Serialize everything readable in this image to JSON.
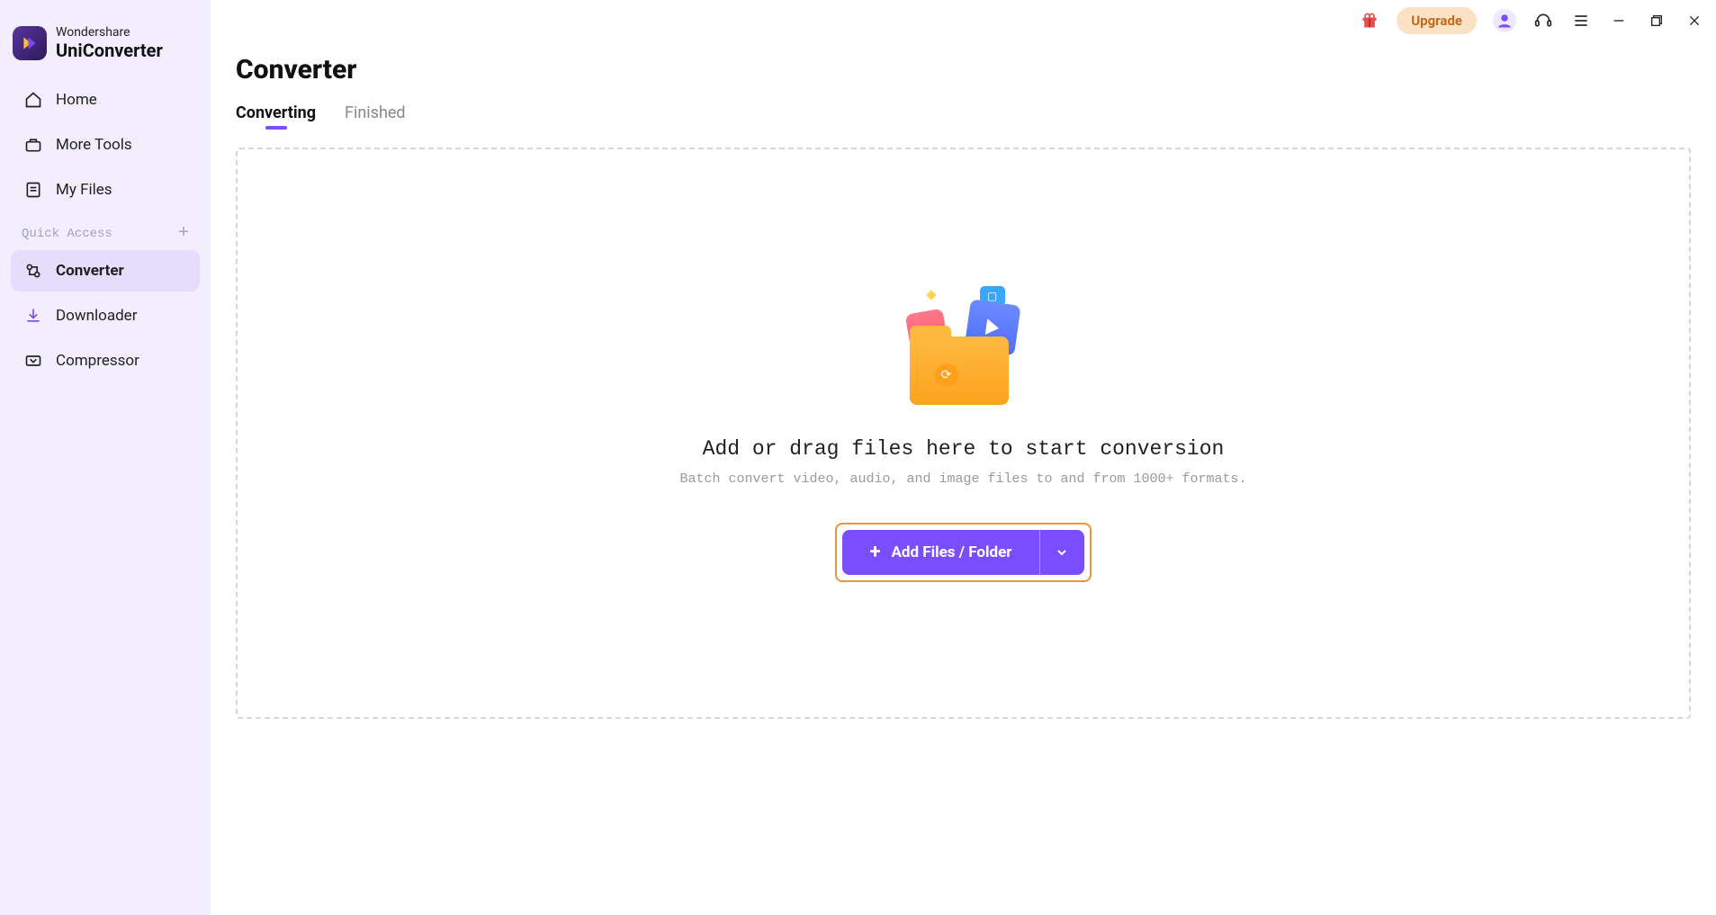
{
  "brand": {
    "top": "Wondershare",
    "bottom": "UniConverter"
  },
  "sidebar": {
    "nav": {
      "home": "Home",
      "more_tools": "More Tools",
      "my_files": "My Files"
    },
    "quick_access_label": "Quick Access",
    "items": {
      "converter": "Converter",
      "downloader": "Downloader",
      "compressor": "Compressor"
    }
  },
  "titlebar": {
    "upgrade": "Upgrade"
  },
  "page": {
    "title": "Converter",
    "tabs": {
      "converting": "Converting",
      "finished": "Finished"
    },
    "drop": {
      "title": "Add or drag files here to start conversion",
      "subtitle": "Batch convert video, audio, and image files to and from 1000+ formats.",
      "add_button": "Add Files / Folder"
    }
  }
}
